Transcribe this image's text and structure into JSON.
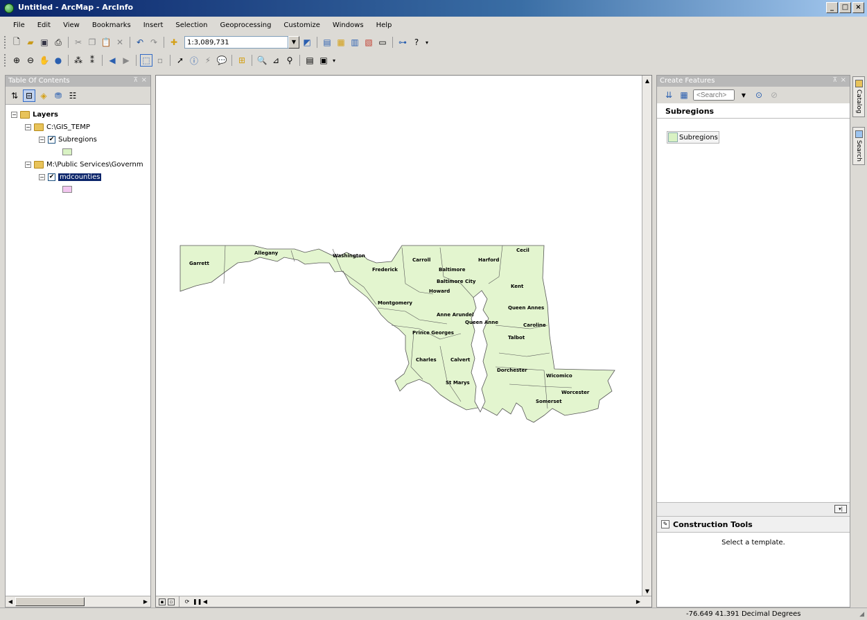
{
  "window": {
    "title": "Untitled - ArcMap - ArcInfo",
    "minimize": "_",
    "maximize": "□",
    "close": "×"
  },
  "menu": [
    "File",
    "Edit",
    "View",
    "Bookmarks",
    "Insert",
    "Selection",
    "Geoprocessing",
    "Customize",
    "Windows",
    "Help"
  ],
  "toolbar": {
    "scale": "1:3,089,731"
  },
  "toc": {
    "title": "Table Of Contents",
    "root": "Layers",
    "groups": [
      {
        "name": "C:\\GIS_TEMP",
        "layer": "Subregions",
        "swatch_color": "#d9f2c3"
      },
      {
        "name": "M:\\Public Services\\Governm",
        "layer": "mdcounties",
        "swatch_color": "#f2c6ef"
      }
    ]
  },
  "map": {
    "fill_color": "#e3f5cf",
    "labels": [
      "Garrett",
      "Allegany",
      "Washington",
      "Frederick",
      "Carroll",
      "Baltimore",
      "Harford",
      "Cecil",
      "Baltimore City",
      "Howard",
      "Kent",
      "Montgomery",
      "Queen Annes",
      "Anne Arundel",
      "Queen Anne",
      "Caroline",
      "Prince Georges",
      "Talbot",
      "Charles",
      "Calvert",
      "Dorchester",
      "Wicomico",
      "St Marys",
      "Worcester",
      "Somerset"
    ]
  },
  "create_features": {
    "title": "Create Features",
    "search_placeholder": "<Search>",
    "section": "Subregions",
    "template": "Subregions",
    "construction_tools": "Construction Tools",
    "message": "Select a template."
  },
  "side_tabs": [
    "Catalog",
    "Search"
  ],
  "status": {
    "coordinates": "-76.649  41.391 Decimal Degrees"
  },
  "icons": [
    "app-icon",
    "new-doc-icon",
    "open-folder-icon",
    "save-icon",
    "print-icon",
    "cut-icon",
    "copy-icon",
    "paste-icon",
    "delete-icon",
    "undo-icon",
    "redo-icon",
    "add-data-icon",
    "zoom-in-icon",
    "zoom-out-icon",
    "pan-icon",
    "full-extent-icon",
    "back-icon",
    "forward-icon",
    "select-icon",
    "identify-icon",
    "find-icon",
    "measure-icon",
    "help-icon"
  ]
}
